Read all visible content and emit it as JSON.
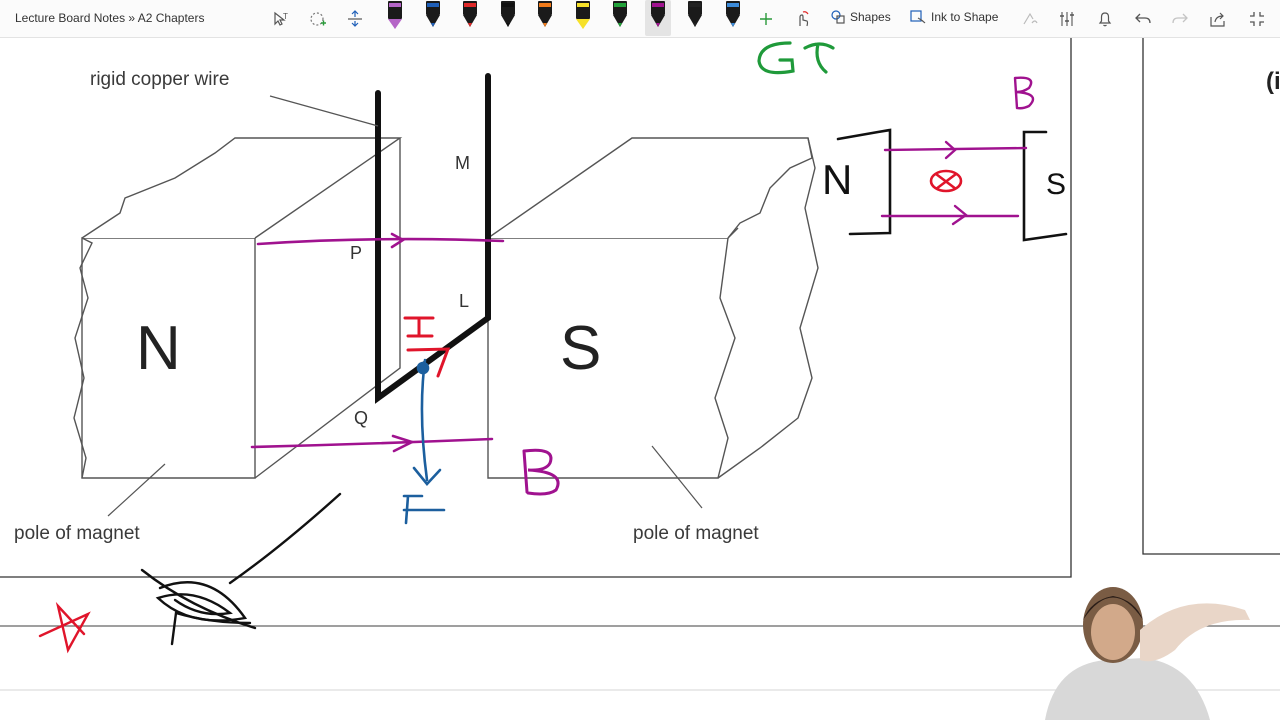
{
  "toolbar": {
    "breadcrumb": "Lecture Board Notes » A2 Chapters",
    "shapes_label": "Shapes",
    "ink_to_shape_label": "Ink to Shape",
    "pens": [
      {
        "name": "highlighter-purple",
        "color": "#b565c7"
      },
      {
        "name": "pen-blue",
        "color": "#1f5fb8"
      },
      {
        "name": "pen-red",
        "color": "#e02a2a"
      },
      {
        "name": "pen-black",
        "color": "#111111"
      },
      {
        "name": "pen-orange",
        "color": "#f07a1a"
      },
      {
        "name": "highlighter-yellow",
        "color": "#f6e12a"
      },
      {
        "name": "pen-green",
        "color": "#22a23a"
      },
      {
        "name": "pen-magenta-active",
        "color": "#a0128f"
      },
      {
        "name": "pen-dark",
        "color": "#222222"
      },
      {
        "name": "pen-lightblue",
        "color": "#3c8bd9"
      }
    ]
  },
  "diagram": {
    "label_rigid_copper_wire": "rigid copper wire",
    "label_pole_left": "pole of magnet",
    "label_pole_right": "pole of magnet",
    "magnet_n": "N",
    "magnet_s": "S",
    "point_m": "M",
    "point_p": "P",
    "point_l": "L",
    "point_q": "Q"
  },
  "ink": {
    "current": "I",
    "force": "F",
    "field": "B",
    "field_small": "B",
    "small_n": "N",
    "small_s": "S",
    "top_note": "Gτ",
    "edge_text": "(i"
  },
  "colors": {
    "magenta": "#a0128f",
    "red": "#e0152b",
    "blue": "#1c5f9e",
    "green": "#1f9a3a",
    "black": "#111111"
  }
}
